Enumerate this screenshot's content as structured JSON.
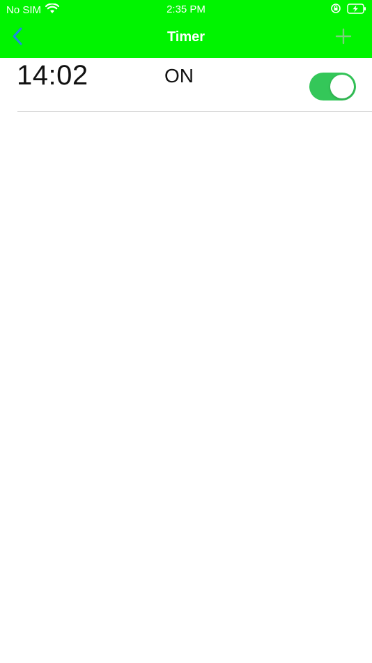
{
  "status_bar": {
    "carrier": "No SIM",
    "time": "2:35 PM",
    "wifi_icon": "wifi-icon",
    "rotation_lock_icon": "rotation-lock-icon",
    "battery_icon": "battery-charging-icon"
  },
  "nav": {
    "title": "Timer",
    "back_icon": "chevron-left-icon",
    "add_icon": "plus-icon"
  },
  "timers": [
    {
      "time": "14:02",
      "state": "ON",
      "enabled": true
    }
  ],
  "colors": {
    "bar": "#00f400",
    "back_arrow": "#1e88e5",
    "toggle_on": "#34c759",
    "plus": "#7ccf7c"
  }
}
